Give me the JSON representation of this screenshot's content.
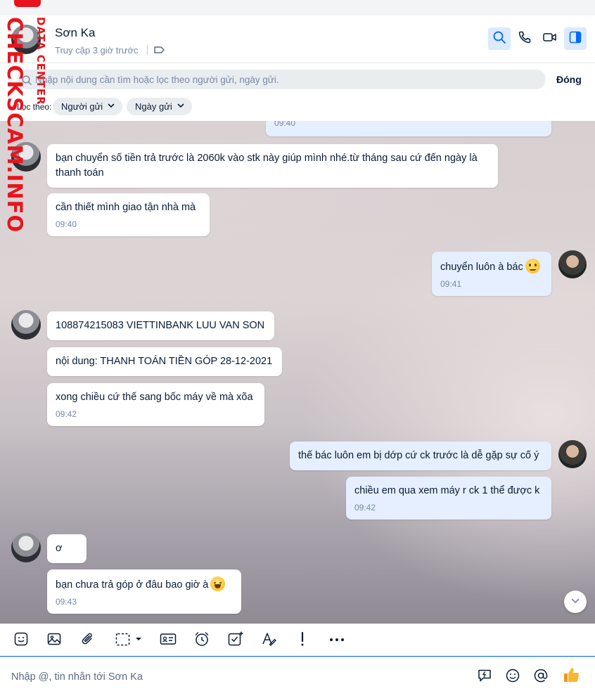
{
  "header": {
    "contact_name": "Sơn Ka",
    "status": "Truy cập 3 giờ trước"
  },
  "search": {
    "placeholder": "Nhập nội dung cần tìm hoặc lọc theo người gửi, ngày gửi.",
    "close_label": "Đóng",
    "filter_label": "Lọc theo:",
    "chip_sender": "Người gửi",
    "chip_date": "Ngày gửi"
  },
  "messages": [
    {
      "time": "09:40"
    },
    {
      "text": "bạn chuyển số tiền trả trước là 2060k vào stk này giúp mình nhé.từ tháng sau cứ đến ngày là thanh toán"
    },
    {
      "text": "cần thiết mình giao tận nhà mà",
      "time": "09:40"
    },
    {
      "text": "chuyển luôn à bác",
      "time": "09:41",
      "emoji": "worried-face-icon"
    },
    {
      "text": "108874215083 VIETTINBANK LUU VAN SON"
    },
    {
      "text": "nội dung: THANH TOÁN TIỀN GÓP 28-12-2021"
    },
    {
      "text": "xong chiều cứ thế sang bốc máy về mà xõa",
      "time": "09:42"
    },
    {
      "text": "thế bác luôn em bị dớp cứ ck trước là dễ gặp sự cố ý"
    },
    {
      "text": "chiều em qua xem máy r ck 1 thể được k",
      "time": "09:42"
    },
    {
      "text": "ơ"
    },
    {
      "text": "bạn chưa trả góp ở đâu bao giờ à",
      "time": "09:43",
      "emoji": "laughing-face-icon"
    }
  ],
  "composer": {
    "placeholder": "Nhập @, tin nhắn tới Sơn Ka"
  },
  "watermark": {
    "main": "CHECKSCAM.INFO",
    "sub": "DATA CENTER"
  },
  "colors": {
    "accent": "#0068ff",
    "outgoing_bubble": "#e5efff",
    "incoming_bubble": "#ffffff",
    "watermark": "#e8141d",
    "like": "#f5a623"
  }
}
